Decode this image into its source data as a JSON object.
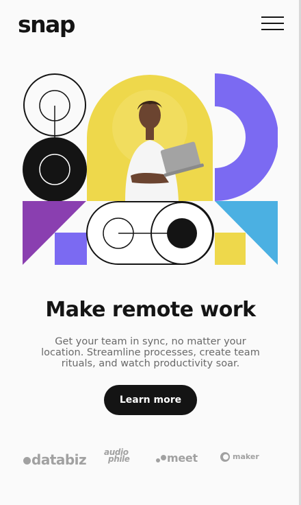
{
  "brand": {
    "logo_text": "snap"
  },
  "header": {
    "menu_icon": "hamburger-menu-icon"
  },
  "hero": {
    "image": "person-with-laptop-geometric-illustration",
    "colors": {
      "yellow": "#eed84b",
      "purple": "#7b6af2",
      "violet": "#8a3fb0",
      "blue": "#4bb0e2",
      "black": "#141414"
    }
  },
  "main": {
    "title": "Make remote work",
    "description": "Get your team in sync, no matter your location. Streamline processes, create team rituals, and watch productivity soar.",
    "cta_label": "Learn more"
  },
  "clients": {
    "databiz": "databiz",
    "audiophile_line1": "audio",
    "audiophile_line2": "phile",
    "meet": "meet",
    "maker": "maker"
  }
}
